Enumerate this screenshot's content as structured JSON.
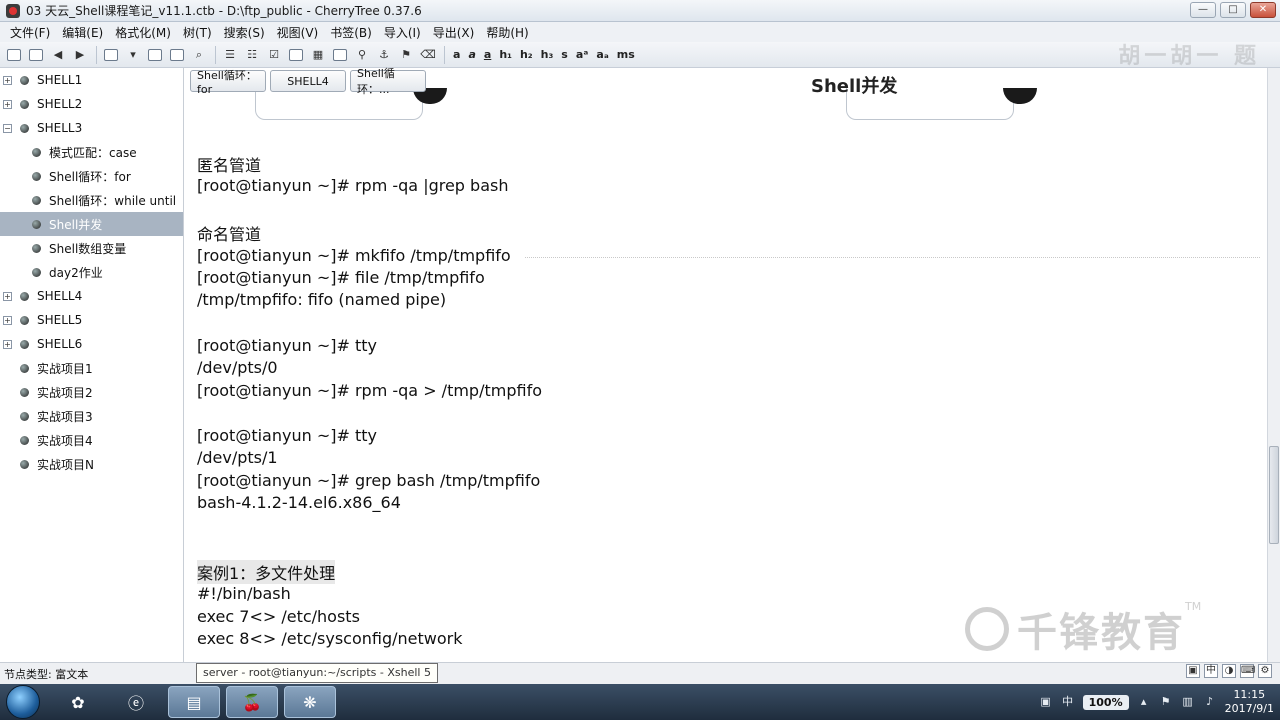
{
  "window": {
    "title": "03 天云_Shell课程笔记_v11.1.ctb - D:\\ftp_public - CherryTree 0.37.6",
    "controls": [
      "—",
      "□",
      "✕"
    ]
  },
  "menu": [
    "文件(F)",
    "编辑(E)",
    "格式化(M)",
    "树(T)",
    "搜索(S)",
    "视图(V)",
    "书签(B)",
    "导入(I)",
    "导出(X)",
    "帮助(H)"
  ],
  "toolbar_text": [
    "a",
    "a",
    "a",
    "h₁",
    "h₂",
    "h₃",
    "s",
    "aᵃ",
    "aₐ",
    "ms"
  ],
  "watermark_top": "胡一胡一 题",
  "tree": [
    {
      "label": "SHELL1",
      "expander": "+",
      "level": 0
    },
    {
      "label": "SHELL2",
      "expander": "+",
      "level": 0
    },
    {
      "label": "SHELL3",
      "expander": "−",
      "level": 0
    },
    {
      "label": "模式匹配：case",
      "level": 1
    },
    {
      "label": "Shell循环：for",
      "level": 1
    },
    {
      "label": "Shell循环：while until",
      "level": 1
    },
    {
      "label": "Shell并发",
      "level": 1,
      "selected": true
    },
    {
      "label": "Shell数组变量",
      "level": 1
    },
    {
      "label": "day2作业",
      "level": 1
    },
    {
      "label": "SHELL4",
      "expander": "+",
      "level": 0
    },
    {
      "label": "SHELL5",
      "expander": "+",
      "level": 0
    },
    {
      "label": "SHELL6",
      "expander": "+",
      "level": 0
    },
    {
      "label": "实战项目1",
      "level": 0
    },
    {
      "label": "实战项目2",
      "level": 0
    },
    {
      "label": "实战项目3",
      "level": 0
    },
    {
      "label": "实战项目4",
      "level": 0
    },
    {
      "label": "实战项目N",
      "level": 0
    }
  ],
  "tabs": [
    "Shell循环：for",
    "SHELL4",
    "Shell循环：..."
  ],
  "node_title": "Shell并发",
  "doc_lines": [
    "匿名管道",
    "[root@tianyun ~]# rpm -qa |grep bash",
    "",
    "命名管道",
    "[root@tianyun ~]# mkfifo /tmp/tmpfifo",
    "[root@tianyun ~]# file /tmp/tmpfifo",
    "/tmp/tmpfifo: fifo (named pipe)",
    "",
    "[root@tianyun ~]# tty",
    "/dev/pts/0",
    "[root@tianyun ~]# rpm -qa > /tmp/tmpfifo",
    "",
    "[root@tianyun ~]# tty",
    "/dev/pts/1",
    "[root@tianyun ~]# grep bash /tmp/tmpfifo",
    "bash-4.1.2-14.el6.x86_64",
    "",
    "",
    "案例1：多文件处理",
    "#!/bin/bash",
    "exec 7<> /etc/hosts",
    "exec 8<> /etc/sysconfig/network"
  ],
  "watermark": {
    "text": "千锋教育",
    "tm": "TM"
  },
  "status": {
    "node_type": "节点类型: 富文本",
    "tooltip": "server - root@tianyun:~/scripts - Xshell 5"
  },
  "taskbar": {
    "ime": "100%",
    "time": "11:15",
    "date": "2017/9/1",
    "tray_ime_char": "中"
  }
}
